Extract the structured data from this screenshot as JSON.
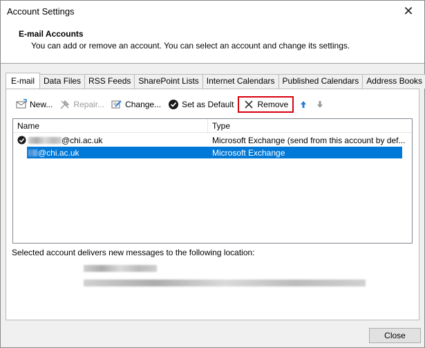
{
  "window": {
    "title": "Account Settings",
    "close_glyph": "✕"
  },
  "header": {
    "title": "E-mail Accounts",
    "description": "You can add or remove an account. You can select an account and change its settings."
  },
  "tabs": [
    {
      "label": "E-mail",
      "active": true
    },
    {
      "label": "Data Files"
    },
    {
      "label": "RSS Feeds"
    },
    {
      "label": "SharePoint Lists"
    },
    {
      "label": "Internet Calendars"
    },
    {
      "label": "Published Calendars"
    },
    {
      "label": "Address Books"
    }
  ],
  "toolbar": {
    "new_label": "New...",
    "repair_label": "Repair...",
    "change_label": "Change...",
    "set_default_label": "Set as Default",
    "remove_label": "Remove",
    "highlight_color": "#d9000d"
  },
  "list": {
    "col_name": "Name",
    "col_type": "Type",
    "rows": [
      {
        "name_suffix": "@chi.ac.uk",
        "type": "Microsoft Exchange (send from this account by def...",
        "default": true,
        "selected": false
      },
      {
        "name_suffix": "@chi.ac.uk",
        "type": "Microsoft Exchange",
        "default": false,
        "selected": true
      }
    ],
    "selection_color": "#0078d7"
  },
  "delivery": {
    "label": "Selected account delivers new messages to the following location:"
  },
  "footer": {
    "close_label": "Close"
  }
}
